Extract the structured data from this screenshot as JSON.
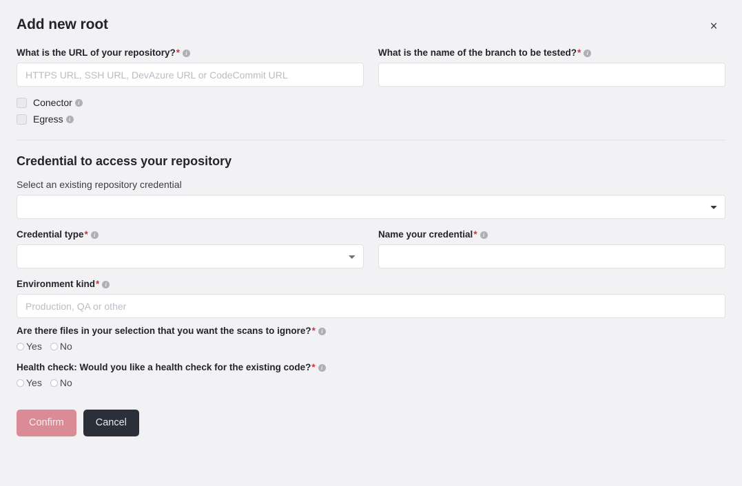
{
  "header": {
    "title": "Add new root",
    "close_label": "×"
  },
  "repository": {
    "url": {
      "label": "What is the URL of your repository?",
      "required_marker": "*",
      "info": "info-icon",
      "placeholder": "HTTPS URL, SSH URL, DevAzure URL or CodeCommit URL",
      "value": ""
    },
    "branch": {
      "label": "What is the name of the branch to be tested?",
      "required_marker": "*",
      "info": "info-icon",
      "placeholder": "",
      "value": ""
    },
    "options": [
      {
        "label": "Conector",
        "checked": false
      },
      {
        "label": "Egress",
        "checked": false
      }
    ]
  },
  "credential": {
    "section_title": "Credential to access your repository",
    "existing": {
      "label": "Select an existing repository credential",
      "selected": "",
      "options": [
        ""
      ]
    },
    "type": {
      "label": "Credential type",
      "required_marker": "*",
      "selected": "",
      "options": [
        ""
      ]
    },
    "name": {
      "label": "Name your credential",
      "required_marker": "*",
      "placeholder": "",
      "value": ""
    }
  },
  "environment": {
    "kind": {
      "label": "Environment kind",
      "required_marker": "*",
      "placeholder": "Production, QA or other",
      "value": ""
    }
  },
  "questions": [
    {
      "label": "Are there files in your selection that you want the scans to ignore?",
      "required_marker": "*",
      "yes_label": "Yes",
      "no_label": "No",
      "selected": ""
    },
    {
      "label": "Health check: Would you like a health check for the existing code?",
      "required_marker": "*",
      "yes_label": "Yes",
      "no_label": "No",
      "selected": ""
    }
  ],
  "footer": {
    "confirm_label": "Confirm",
    "cancel_label": "Cancel"
  },
  "colors": {
    "background": "#f2f2f4",
    "confirm": "#da8b96",
    "cancel": "#2b2f3a",
    "required": "#d0323f",
    "border": "#dfe1e5"
  }
}
